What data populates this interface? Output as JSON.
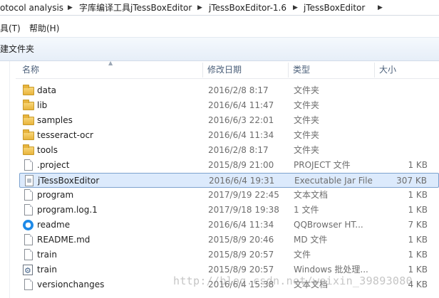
{
  "address": {
    "crumbs": [
      "otocol analysis",
      "字库编译工具jTessBoxEditor",
      "jTessBoxEditor-1.6",
      "jTessBoxEditor"
    ]
  },
  "menu": {
    "items": [
      "具(T)",
      "帮助(H)"
    ]
  },
  "toolbar": {
    "new_folder_label": "建文件夹"
  },
  "columns": {
    "name": "名称",
    "date": "修改日期",
    "type": "类型",
    "size": "大小"
  },
  "files": [
    {
      "name": "data",
      "date": "2016/2/8 8:17",
      "type": "文件夹",
      "size": "",
      "icon": "folder-icon"
    },
    {
      "name": "lib",
      "date": "2016/6/4 11:47",
      "type": "文件夹",
      "size": "",
      "icon": "folder-icon"
    },
    {
      "name": "samples",
      "date": "2016/6/3 22:01",
      "type": "文件夹",
      "size": "",
      "icon": "folder-icon"
    },
    {
      "name": "tesseract-ocr",
      "date": "2016/6/4 11:34",
      "type": "文件夹",
      "size": "",
      "icon": "folder-icon"
    },
    {
      "name": "tools",
      "date": "2016/2/8 8:17",
      "type": "文件夹",
      "size": "",
      "icon": "folder-icon"
    },
    {
      "name": ".project",
      "date": "2015/8/9 21:00",
      "type": "PROJECT 文件",
      "size": "1 KB",
      "icon": "file-icon"
    },
    {
      "name": "jTessBoxEditor",
      "date": "2016/6/4 19:31",
      "type": "Executable Jar File",
      "size": "307 KB",
      "icon": "jar-file-icon"
    },
    {
      "name": "program",
      "date": "2017/9/19 22:45",
      "type": "文本文档",
      "size": "1 KB",
      "icon": "file-icon"
    },
    {
      "name": "program.log.1",
      "date": "2017/9/18 19:38",
      "type": "1 文件",
      "size": "1 KB",
      "icon": "file-icon"
    },
    {
      "name": "readme",
      "date": "2016/6/4 11:34",
      "type": "QQBrowser HT...",
      "size": "7 KB",
      "icon": "browser-icon"
    },
    {
      "name": "README.md",
      "date": "2015/8/9 20:46",
      "type": "MD 文件",
      "size": "1 KB",
      "icon": "file-icon"
    },
    {
      "name": "train",
      "date": "2015/8/9 20:57",
      "type": "文件",
      "size": "1 KB",
      "icon": "file-icon"
    },
    {
      "name": "train",
      "date": "2015/8/9 20:57",
      "type": "Windows 批处理...",
      "size": "1 KB",
      "icon": "batch-file-icon"
    },
    {
      "name": "versionchanges",
      "date": "2016/6/4 15:38",
      "type": "文本文档",
      "size": "4 KB",
      "icon": "file-icon"
    }
  ],
  "selected_index": 6,
  "watermark": "http://blog.csdn.net/weixin_39893080"
}
